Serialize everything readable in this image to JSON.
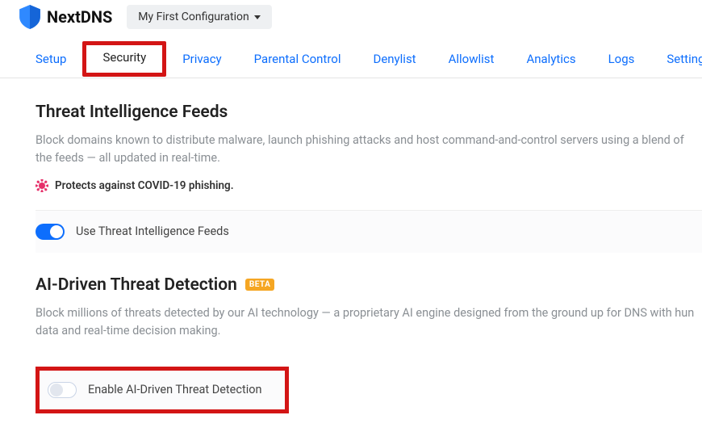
{
  "brand": "NextDNS",
  "config_selector": {
    "label": "My First Configuration"
  },
  "tabs": {
    "setup": "Setup",
    "security": "Security",
    "privacy": "Privacy",
    "parental": "Parental Control",
    "denylist": "Denylist",
    "allowlist": "Allowlist",
    "analytics": "Analytics",
    "logs": "Logs",
    "settings": "Settings"
  },
  "sections": {
    "threat_feeds": {
      "title": "Threat Intelligence Feeds",
      "desc": "Block domains known to distribute malware, launch phishing attacks and host command-and-control servers using a blend of the feeds — all updated in real-time.",
      "covid_note": "Protects against COVID-19 phishing.",
      "toggle_label": "Use Threat Intelligence Feeds"
    },
    "ai_threat": {
      "title": "AI-Driven Threat Detection",
      "badge": "BETA",
      "desc": "Block millions of threats detected by our AI technology — a proprietary AI engine designed from the ground up for DNS with hun data and real-time decision making.",
      "toggle_label": "Enable AI-Driven Threat Detection"
    }
  }
}
